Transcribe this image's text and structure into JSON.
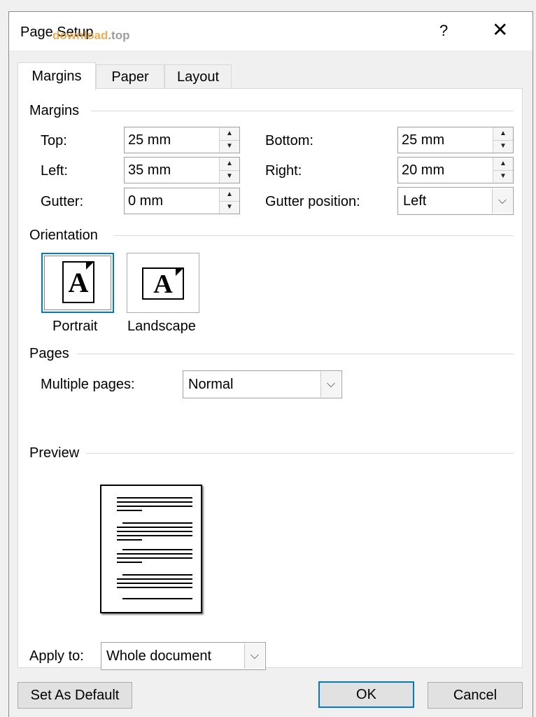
{
  "window": {
    "title": "Page Setup",
    "watermark_main": "download",
    "watermark_suffix": ".top",
    "help_label": "?",
    "close_label": "✕"
  },
  "tabs": [
    {
      "label": "Margins",
      "active": true
    },
    {
      "label": "Paper",
      "active": false
    },
    {
      "label": "Layout",
      "active": false
    }
  ],
  "margins": {
    "section_label": "Margins",
    "top": {
      "label": "Top:",
      "value": "25 mm"
    },
    "bottom": {
      "label": "Bottom:",
      "value": "25 mm"
    },
    "left": {
      "label": "Left:",
      "value": "35 mm"
    },
    "right": {
      "label": "Right:",
      "value": "20 mm"
    },
    "gutter": {
      "label": "Gutter:",
      "value": "0 mm"
    },
    "gutter_position": {
      "label": "Gutter position:",
      "value": "Left"
    }
  },
  "orientation": {
    "section_label": "Orientation",
    "portrait_label": "Portrait",
    "landscape_label": "Landscape",
    "glyph": "A",
    "selected": "portrait"
  },
  "pages": {
    "section_label": "Pages",
    "multiple_pages_label": "Multiple pages:",
    "multiple_pages_value": "Normal"
  },
  "preview": {
    "section_label": "Preview"
  },
  "apply_to": {
    "label": "Apply to:",
    "value": "Whole document"
  },
  "buttons": {
    "set_default": "Set As Default",
    "ok": "OK",
    "cancel": "Cancel"
  },
  "colors": {
    "focus_blue": "#0078d7",
    "watermark_orange": "#e8a23a"
  }
}
